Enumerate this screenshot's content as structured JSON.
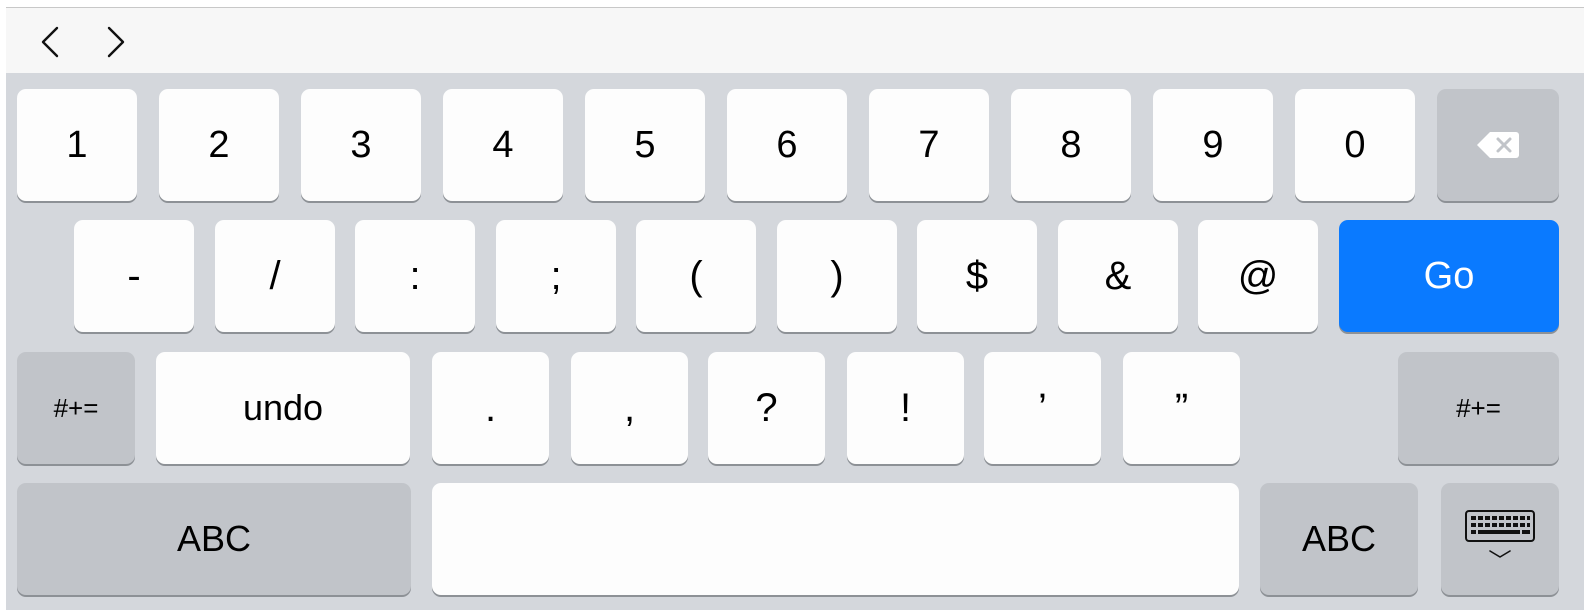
{
  "toolbar": {
    "back_icon": "chevron-left-icon",
    "forward_icon": "chevron-right-icon"
  },
  "keyboard": {
    "row1": [
      "1",
      "2",
      "3",
      "4",
      "5",
      "6",
      "7",
      "8",
      "9",
      "0"
    ],
    "row2": [
      "-",
      "/",
      ":",
      ";",
      "(",
      ")",
      "$",
      "&",
      "@"
    ],
    "go_label": "Go",
    "go_color": "#0a7aff",
    "row3_mode_left": "#+=",
    "row3_undo": "undo",
    "row3": [
      ".",
      ",",
      "?",
      "!",
      "’",
      "”"
    ],
    "row3_mode_right": "#+=",
    "abc_left": "ABC",
    "space_label": "",
    "abc_right": "ABC",
    "delete_icon": "backspace-icon",
    "hide_icon": "keyboard-hide-icon"
  }
}
